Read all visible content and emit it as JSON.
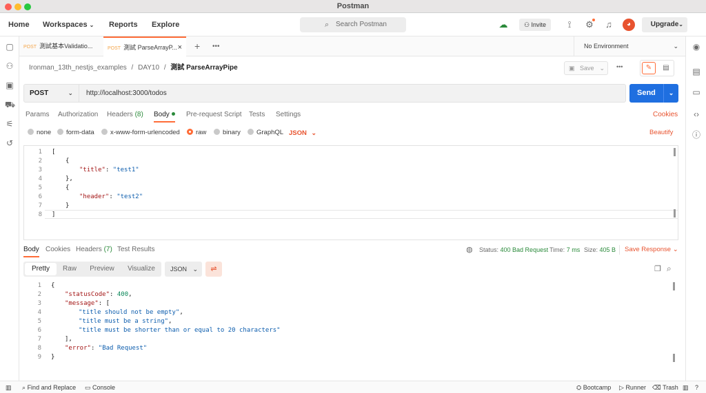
{
  "window": {
    "title": "Postman"
  },
  "nav": {
    "home": "Home",
    "workspaces": "Workspaces",
    "reports": "Reports",
    "explore": "Explore",
    "search_placeholder": "Search Postman",
    "invite": "Invite",
    "upgrade": "Upgrade"
  },
  "tabs": [
    {
      "method": "POST",
      "title": "測試基本Validatio..."
    },
    {
      "method": "POST",
      "title": "測試 ParseArrayP..."
    }
  ],
  "environment": "No Environment",
  "breadcrumb": {
    "collection": "Ironman_13th_nestjs_examples",
    "folder": "DAY10",
    "request": "測試 ParseArrayPipe",
    "sep1": "/",
    "sep2": "/"
  },
  "save_label": "Save",
  "request": {
    "method": "POST",
    "url": "http://localhost:3000/todos",
    "send": "Send"
  },
  "req_tabs": {
    "params": "Params",
    "authorization": "Authorization",
    "headers": "Headers",
    "headers_count": "(8)",
    "body": "Body",
    "prerequest": "Pre-request Script",
    "tests": "Tests",
    "settings": "Settings",
    "cookies": "Cookies"
  },
  "body_types": {
    "none": "none",
    "form_data": "form-data",
    "urlencoded": "x-www-form-urlencoded",
    "raw": "raw",
    "binary": "binary",
    "graphql": "GraphQL",
    "json": "JSON",
    "beautify": "Beautify"
  },
  "request_body_lines": [
    "1",
    "2",
    "3",
    "4",
    "5",
    "6",
    "7",
    "8"
  ],
  "req_code": {
    "open_bracket": "[",
    "open_brace": "{",
    "title_key": "\"title\"",
    "title_val": "\"test1\"",
    "close_brace_comma": "},",
    "header_key": "\"header\"",
    "header_val": "\"test2\"",
    "close_brace": "}",
    "close_bracket": "]",
    "colon": ": "
  },
  "res_tabs": {
    "body": "Body",
    "cookies": "Cookies",
    "headers": "Headers",
    "headers_count": "(7)",
    "test_results": "Test Results"
  },
  "status": {
    "status_label": "Status:",
    "status_value": "400 Bad Request",
    "time_label": "Time:",
    "time_value": "7 ms",
    "size_label": "Size:",
    "size_value": "405 B",
    "save_response": "Save Response"
  },
  "res_views": {
    "pretty": "Pretty",
    "raw": "Raw",
    "preview": "Preview",
    "visualize": "Visualize",
    "format": "JSON"
  },
  "response_lines": [
    "1",
    "2",
    "3",
    "4",
    "5",
    "6",
    "7",
    "8",
    "9"
  ],
  "res_code": {
    "open": "{",
    "status_key": "\"statusCode\"",
    "status_val": "400",
    "message_key": "\"message\"",
    "open_bracket": "[",
    "m1": "\"title should not be empty\"",
    "m2": "\"title must be a string\"",
    "m3": "\"title must be shorter than or equal to 20 characters\"",
    "close_bracket": "],",
    "error_key": "\"error\"",
    "error_val": "\"Bad Request\"",
    "close": "}"
  },
  "footer": {
    "find_replace": "Find and Replace",
    "console": "Console",
    "bootcamp": "Bootcamp",
    "runner": "Runner",
    "trash": "Trash"
  },
  "colors": {
    "accent": "#ff6c37",
    "send": "#1f6fe0",
    "status_ok": "#2a8a3a"
  }
}
